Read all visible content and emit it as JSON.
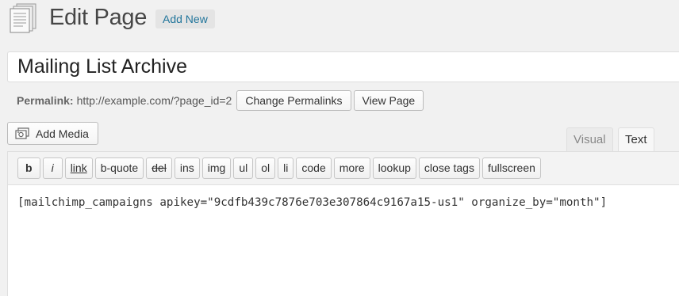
{
  "header": {
    "title": "Edit Page",
    "add_new_label": "Add New",
    "icon": "page-icon"
  },
  "post": {
    "title": "Mailing List Archive"
  },
  "permalink": {
    "label": "Permalink:",
    "url": "http://example.com/?page_id=2",
    "change_label": "Change Permalinks",
    "view_label": "View Page"
  },
  "media": {
    "add_media_label": "Add Media",
    "icon": "media-icon"
  },
  "editor_tabs": {
    "visual": "Visual",
    "text": "Text",
    "active": "text"
  },
  "quicktags": [
    "b",
    "i",
    "link",
    "b-quote",
    "del",
    "ins",
    "img",
    "ul",
    "ol",
    "li",
    "code",
    "more",
    "lookup",
    "close tags",
    "fullscreen"
  ],
  "content": "[mailchimp_campaigns apikey=\"9cdfb439c7876e703e307864c9167a15-us1\" organize_by=\"month\"]"
}
